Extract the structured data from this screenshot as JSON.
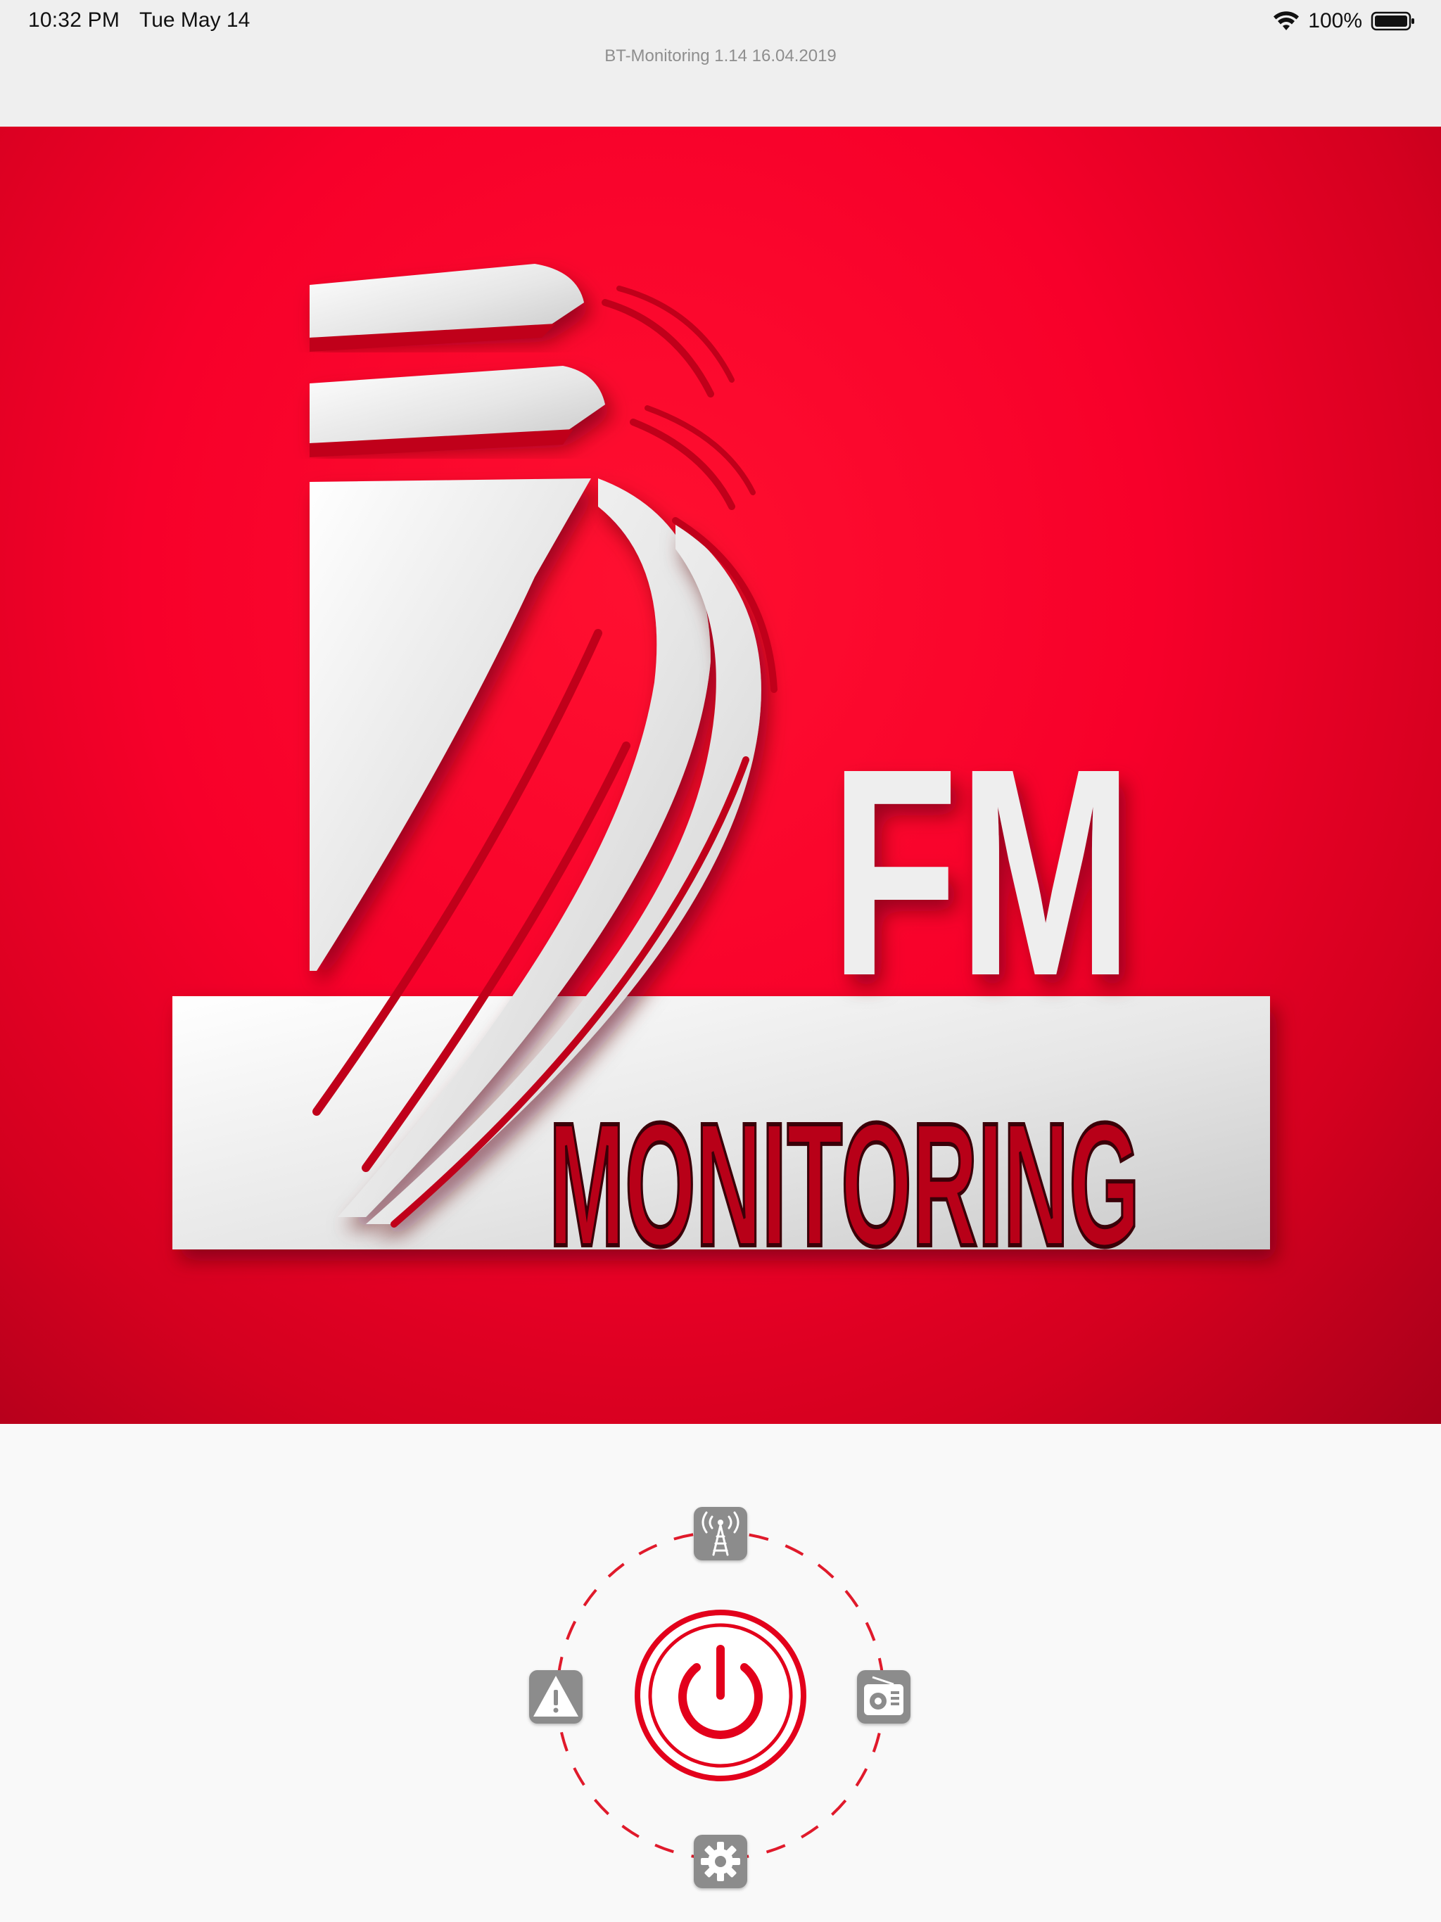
{
  "status_bar": {
    "time": "10:32 PM",
    "date": "Tue May 14",
    "battery": "100%"
  },
  "header": {
    "title": "BT-Monitoring 1.14 16.04.2019"
  },
  "logo": {
    "wordmark_top": "FM",
    "wordmark_bottom": "MONITORING"
  },
  "controls": {
    "top_icon": "antenna-tower-icon",
    "left_icon": "warning-icon",
    "right_icon": "radio-icon",
    "bottom_icon": "gear-icon",
    "center_icon": "power-icon"
  },
  "colors": {
    "brand_red": "#e3001b",
    "banner_red": "#f7002a",
    "icon_gray": "#8c8c8c"
  }
}
